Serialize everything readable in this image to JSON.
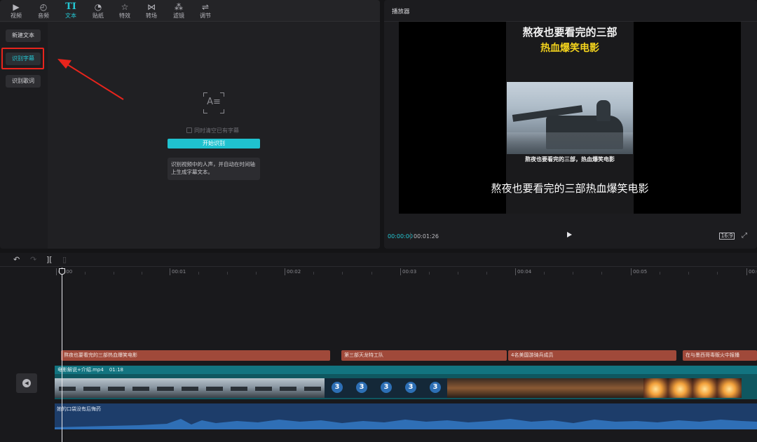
{
  "toolbar": {
    "tabs": [
      {
        "label": "视频",
        "icon": "video-icon",
        "glyph": "▶"
      },
      {
        "label": "音频",
        "icon": "audio-icon",
        "glyph": "◴"
      },
      {
        "label": "文本",
        "icon": "text-icon",
        "glyph": "TI"
      },
      {
        "label": "贴纸",
        "icon": "sticker-icon",
        "glyph": "◔"
      },
      {
        "label": "特效",
        "icon": "effects-icon",
        "glyph": "☆"
      },
      {
        "label": "转场",
        "icon": "transition-icon",
        "glyph": "⋈"
      },
      {
        "label": "滤镜",
        "icon": "filter-icon",
        "glyph": "⁂"
      },
      {
        "label": "调节",
        "icon": "adjust-icon",
        "glyph": "⇌"
      }
    ],
    "active_tab": "文本"
  },
  "sidebar": {
    "items": [
      {
        "label": "新建文本"
      },
      {
        "label": "识别字幕"
      },
      {
        "label": "识别歌词"
      }
    ],
    "active_item": "识别字幕"
  },
  "recognize": {
    "icon_text": "A≡",
    "clear_checkbox_label": "同时清空已有字幕",
    "start_button": "开始识别",
    "tip": "识别视频中的人声，并自动在时间轴上生成字幕文本。"
  },
  "player": {
    "title": "播放器",
    "video_title_line1": "熬夜也要看完的三部",
    "video_title_line2": "热血爆笑电影",
    "video_inner_subtitle": "熬夜也要看完的三部，热血爆笑电影",
    "subtitle": "熬夜也要看完的三部热血爆笑电影",
    "current_time": "00:00:00",
    "total_time": "00:01:26",
    "aspect_ratio": "16:9"
  },
  "timeline": {
    "ruler_labels": [
      "00:00",
      "00:01",
      "00:02",
      "00:03",
      "00:04",
      "00:05",
      "00:06"
    ],
    "subtitle_clips": [
      "熬夜也要看完的三部热血爆笑电影",
      "第三部天龙特工队",
      "4名美国游骑兵成员",
      "在与墨西哥毒贩火中报播"
    ],
    "video_clip_name": "电影解说+介绍.mp4",
    "video_clip_duration": "01:18",
    "audio_clip_name": "她的口袋没有后悔药"
  },
  "colors": {
    "accent": "#1fc2cf",
    "highlight": "#e8241c",
    "subtitle_clip": "#a0493a",
    "video_track": "#0f5760",
    "audio_track": "#1d3d6a"
  }
}
